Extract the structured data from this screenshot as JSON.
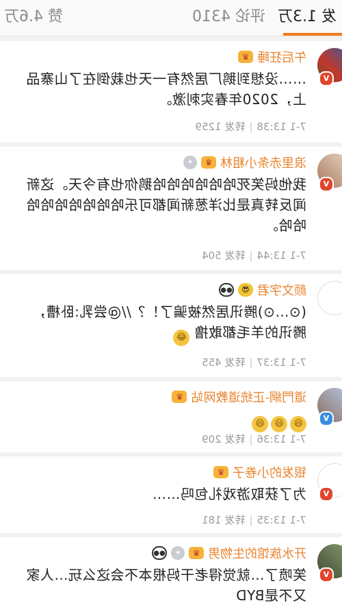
{
  "tabs": {
    "repost": "发 1.3万",
    "comment": "评论 4310",
    "like": "赞 4.6万"
  },
  "comments": [
    {
      "name": "午后狂睡",
      "badges": [
        "crown"
      ],
      "verified": "V",
      "text": "……没想到鹅厂居然有一天也栽倒在了山寨品上，2020年春实刺激。",
      "time": "7-1 13:38",
      "repost": "转发 1259"
    },
    {
      "name": "浪里赤条小粗林",
      "badges": [
        "crown",
        "silver"
      ],
      "verified": "V",
      "text": "我他妈笑死哈哈哈哈哈哈鹅你也有今天。这新闻反转真是比洋葱新闻都可乐哈哈哈哈哈哈哈哈哈。",
      "time": "7-1 13:44",
      "repost": "转发 504"
    },
    {
      "name": "颜文字君",
      "badges": [
        "sunglass",
        "panda"
      ],
      "verified": "",
      "text": "(⊙…⊙)腾讯居然被骗了！？//@尝乳:卧槽，腾讯的羊毛都敢撸",
      "emoji_tail": "😂",
      "time": "7-1 13:37",
      "repost": "转发 455"
    },
    {
      "name": "道門網-正统道教网站",
      "badges": [
        "crown"
      ],
      "verified": "V",
      "text": "",
      "emoji_tail": "😆😆😆",
      "time": "7-1 13:36",
      "repost": "转发 209"
    },
    {
      "name": "银发的小卷子",
      "badges": [
        "crown"
      ],
      "verified": "V",
      "text": "为了获取游戏礼包吗……",
      "time": "7-1 13:35",
      "repost": "转发 181"
    },
    {
      "name": "开水族馆的生物男",
      "badges": [
        "crown",
        "silver",
        "panda"
      ],
      "verified": "V",
      "text": "笑喷了…就觉得老干妈根本不会这么玩…人家又不是BYD",
      "time": "",
      "repost": ""
    }
  ],
  "colors": {
    "accent": "#f27a1a",
    "name": "#e98532",
    "verified_red": "#e0452c",
    "verified_blue": "#3a8de0"
  }
}
